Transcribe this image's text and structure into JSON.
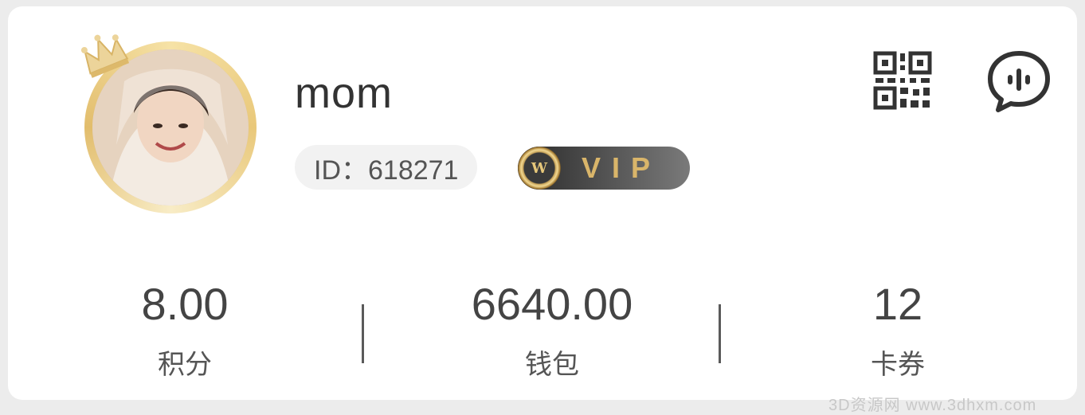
{
  "profile": {
    "username": "mom",
    "id_text": "ID：618271",
    "vip_label": "VIP"
  },
  "stats": [
    {
      "value": "8.00",
      "label": "积分"
    },
    {
      "value": "6640.00",
      "label": "钱包"
    },
    {
      "value": "12",
      "label": "卡券"
    }
  ],
  "icons": {
    "qr": "qr-code-icon",
    "chat": "chat-bubble-icon",
    "crown": "crown-icon"
  },
  "colors": {
    "gold": "#e2bd6c",
    "vip_text": "#d9b56a",
    "text_primary": "#333333"
  },
  "watermark": "3D资源网 www.3dhxm.com"
}
